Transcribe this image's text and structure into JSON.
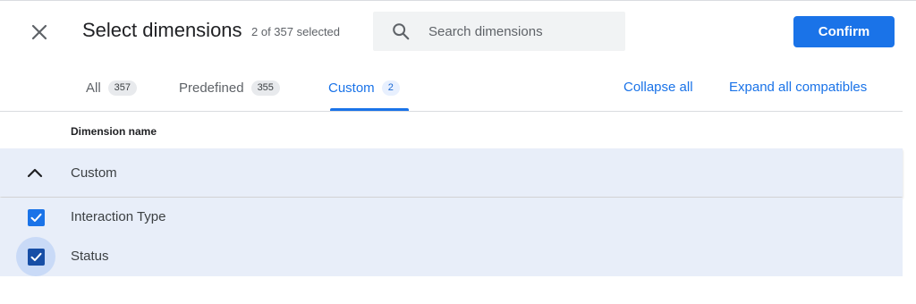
{
  "dialog": {
    "title": "Select dimensions",
    "selection_count": "2 of 357 selected",
    "confirm_label": "Confirm"
  },
  "search": {
    "placeholder": "Search dimensions",
    "value": ""
  },
  "tabs": [
    {
      "label": "All",
      "count": "357",
      "active": false
    },
    {
      "label": "Predefined",
      "count": "355",
      "active": false
    },
    {
      "label": "Custom",
      "count": "2",
      "active": true
    }
  ],
  "actions": {
    "collapse_all": "Collapse all",
    "expand_all": "Expand all compatibles"
  },
  "table": {
    "column_header": "Dimension name",
    "group": {
      "label": "Custom",
      "expanded": true,
      "icon": "chevron-up-icon"
    },
    "items": [
      {
        "label": "Interaction Type",
        "checked": true
      },
      {
        "label": "Status",
        "checked": true
      }
    ]
  },
  "icons": {
    "close": "close-icon",
    "search": "search-icon",
    "checkbox": "checkbox-checked-icon"
  },
  "colors": {
    "accent": "#1a73e8",
    "row_highlight": "#e8eef9",
    "focus_ring": "#c9daf7"
  }
}
